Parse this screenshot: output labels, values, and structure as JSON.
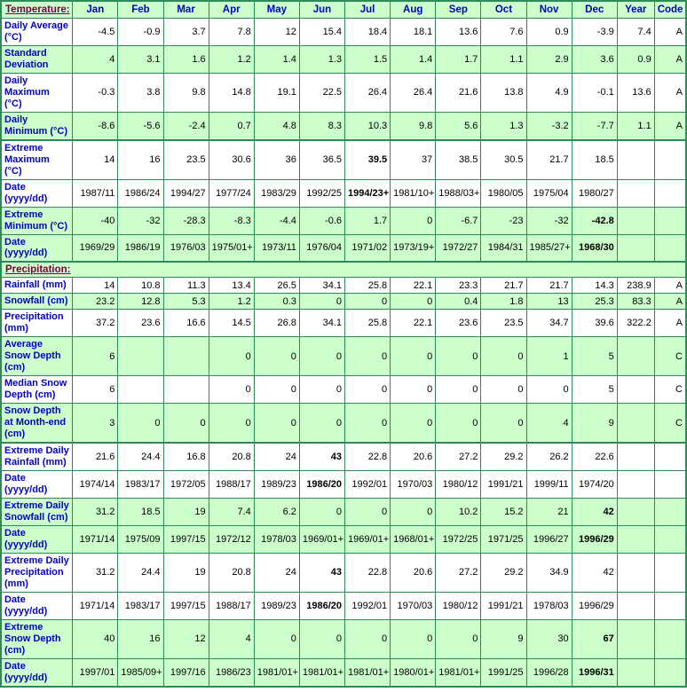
{
  "table": {
    "columns": [
      "Jan",
      "Feb",
      "Mar",
      "Apr",
      "May",
      "Jun",
      "Jul",
      "Aug",
      "Sep",
      "Oct",
      "Nov",
      "Dec",
      "Year",
      "Code"
    ],
    "section_temperature_label": "Temperature:",
    "section_precipitation_label": "Precipitation:",
    "rows": [
      {
        "label": "Daily Average (°C)",
        "band": "white",
        "values": [
          "-4.5",
          "-0.9",
          "3.7",
          "7.8",
          "12",
          "15.4",
          "18.4",
          "18.1",
          "13.6",
          "7.6",
          "0.9",
          "-3.9",
          "7.4",
          "A"
        ],
        "bold": []
      },
      {
        "label": "Standard Deviation",
        "band": "green",
        "values": [
          "4",
          "3.1",
          "1.6",
          "1.2",
          "1.4",
          "1.3",
          "1.5",
          "1.4",
          "1.7",
          "1.1",
          "2.9",
          "3.6",
          "0.9",
          "A"
        ],
        "bold": []
      },
      {
        "label": "Daily Maximum (°C)",
        "band": "white",
        "values": [
          "-0.3",
          "3.8",
          "9.8",
          "14.8",
          "19.1",
          "22.5",
          "26.4",
          "26.4",
          "21.6",
          "13.8",
          "4.9",
          "-0.1",
          "13.6",
          "A"
        ],
        "bold": []
      },
      {
        "label": "Daily Minimum (°C)",
        "band": "green",
        "values": [
          "-8.6",
          "-5.6",
          "-2.4",
          "0.7",
          "4.8",
          "8.3",
          "10.3",
          "9.8",
          "5.6",
          "1.3",
          "-3.2",
          "-7.7",
          "1.1",
          "A"
        ],
        "bold": [],
        "group_end": true
      },
      {
        "label": "Extreme Maximum (°C)",
        "band": "white",
        "values": [
          "14",
          "16",
          "23.5",
          "30.6",
          "36",
          "36.5",
          "39.5",
          "37",
          "38.5",
          "30.5",
          "21.7",
          "18.5",
          "",
          ""
        ],
        "bold": [
          6
        ]
      },
      {
        "label": "Date (yyyy/dd)",
        "band": "white",
        "values": [
          "1987/11",
          "1986/24",
          "1994/27",
          "1977/24",
          "1983/29",
          "1992/25",
          "1994/23+",
          "1981/10+",
          "1988/03+",
          "1980/05",
          "1975/04",
          "1980/27",
          "",
          ""
        ],
        "bold": [
          6
        ]
      },
      {
        "label": "Extreme Minimum (°C)",
        "band": "green",
        "values": [
          "-40",
          "-32",
          "-28.3",
          "-8.3",
          "-4.4",
          "-0.6",
          "1.7",
          "0",
          "-6.7",
          "-23",
          "-32",
          "-42.8",
          "",
          ""
        ],
        "bold": [
          11
        ]
      },
      {
        "label": "Date (yyyy/dd)",
        "band": "green",
        "values": [
          "1969/29",
          "1986/19",
          "1976/03",
          "1975/01+",
          "1973/11",
          "1976/04",
          "1971/02",
          "1973/19+",
          "1972/27",
          "1984/31",
          "1985/27+",
          "1968/30",
          "",
          ""
        ],
        "bold": [
          11
        ],
        "group_end": true
      },
      {
        "label": "Rainfall (mm)",
        "band": "white",
        "values": [
          "14",
          "10.8",
          "11.3",
          "13.4",
          "26.5",
          "34.1",
          "25.8",
          "22.1",
          "23.3",
          "21.7",
          "21.7",
          "14.3",
          "238.9",
          "A"
        ],
        "bold": []
      },
      {
        "label": "Snowfall (cm)",
        "band": "green",
        "values": [
          "23.2",
          "12.8",
          "5.3",
          "1.2",
          "0.3",
          "0",
          "0",
          "0",
          "0.4",
          "1.8",
          "13",
          "25.3",
          "83.3",
          "A"
        ],
        "bold": []
      },
      {
        "label": "Precipitation (mm)",
        "band": "white",
        "values": [
          "37.2",
          "23.6",
          "16.6",
          "14.5",
          "26.8",
          "34.1",
          "25.8",
          "22.1",
          "23.6",
          "23.5",
          "34.7",
          "39.6",
          "322.2",
          "A"
        ],
        "bold": []
      },
      {
        "label": "Average Snow Depth (cm)",
        "band": "green",
        "values": [
          "6",
          "",
          "",
          "0",
          "0",
          "0",
          "0",
          "0",
          "0",
          "0",
          "1",
          "5",
          "",
          "C"
        ],
        "bold": []
      },
      {
        "label": "Median Snow Depth (cm)",
        "band": "white",
        "values": [
          "6",
          "",
          "",
          "0",
          "0",
          "0",
          "0",
          "0",
          "0",
          "0",
          "0",
          "5",
          "",
          "C"
        ],
        "bold": []
      },
      {
        "label": "Snow Depth at Month-end (cm)",
        "band": "green",
        "values": [
          "3",
          "0",
          "0",
          "0",
          "0",
          "0",
          "0",
          "0",
          "0",
          "0",
          "4",
          "9",
          "",
          "C"
        ],
        "bold": [],
        "group_end": true
      },
      {
        "label": "Extreme Daily Rainfall (mm)",
        "band": "white",
        "values": [
          "21.6",
          "24.4",
          "16.8",
          "20.8",
          "24",
          "43",
          "22.8",
          "20.6",
          "27.2",
          "29.2",
          "26.2",
          "22.6",
          "",
          ""
        ],
        "bold": [
          5
        ]
      },
      {
        "label": "Date (yyyy/dd)",
        "band": "white",
        "values": [
          "1974/14",
          "1983/17",
          "1972/05",
          "1988/17",
          "1989/23",
          "1986/20",
          "1992/01",
          "1970/03",
          "1980/12",
          "1991/21",
          "1999/11",
          "1974/20",
          "",
          ""
        ],
        "bold": [
          5
        ]
      },
      {
        "label": "Extreme Daily Snowfall (cm)",
        "band": "green",
        "values": [
          "31.2",
          "18.5",
          "19",
          "7.4",
          "6.2",
          "0",
          "0",
          "0",
          "10.2",
          "15.2",
          "21",
          "42",
          "",
          ""
        ],
        "bold": [
          11
        ]
      },
      {
        "label": "Date (yyyy/dd)",
        "band": "green",
        "values": [
          "1971/14",
          "1975/09",
          "1997/15",
          "1972/12",
          "1978/03",
          "1969/01+",
          "1969/01+",
          "1968/01+",
          "1972/25",
          "1971/25",
          "1996/27",
          "1996/29",
          "",
          ""
        ],
        "bold": [
          11
        ]
      },
      {
        "label": "Extreme Daily Precipitation (mm)",
        "band": "white",
        "values": [
          "31.2",
          "24.4",
          "19",
          "20.8",
          "24",
          "43",
          "22.8",
          "20.6",
          "27.2",
          "29.2",
          "34.9",
          "42",
          "",
          ""
        ],
        "bold": [
          5
        ]
      },
      {
        "label": "Date (yyyy/dd)",
        "band": "white",
        "values": [
          "1971/14",
          "1983/17",
          "1997/15",
          "1988/17",
          "1989/23",
          "1986/20",
          "1992/01",
          "1970/03",
          "1980/12",
          "1991/21",
          "1978/03",
          "1996/29",
          "",
          ""
        ],
        "bold": [
          5
        ]
      },
      {
        "label": "Extreme Snow Depth (cm)",
        "band": "green",
        "values": [
          "40",
          "16",
          "12",
          "4",
          "0",
          "0",
          "0",
          "0",
          "0",
          "9",
          "30",
          "67",
          "",
          ""
        ],
        "bold": [
          11
        ]
      },
      {
        "label": "Date (yyyy/dd)",
        "band": "green",
        "values": [
          "1997/01",
          "1985/09+",
          "1997/16",
          "1986/23",
          "1981/01+",
          "1981/01+",
          "1981/01+",
          "1980/01+",
          "1981/01+",
          "1991/25",
          "1996/28",
          "1996/31",
          "",
          ""
        ],
        "bold": [
          11
        ]
      }
    ],
    "precipitation_section_after_row_index": 7
  }
}
